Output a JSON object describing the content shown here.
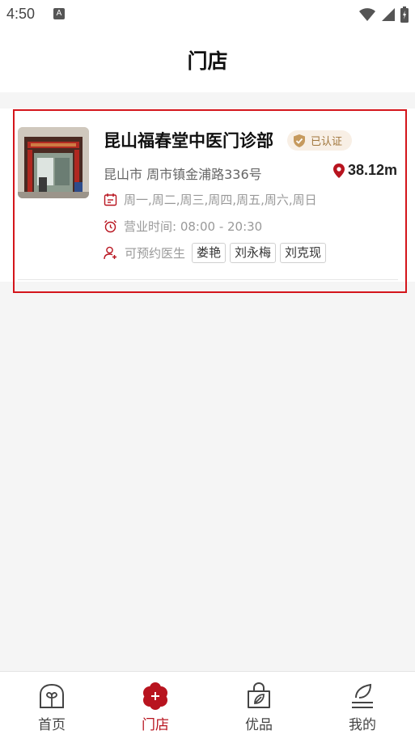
{
  "status_bar": {
    "time": "4:50",
    "app_badge": "A"
  },
  "header": {
    "title": "门店"
  },
  "store": {
    "name": "昆山福春堂中医门诊部",
    "verified": "已认证",
    "address": "昆山市 周市镇金浦路336号",
    "distance": "38.12m",
    "days": "周一,周二,周三,周四,周五,周六,周日",
    "hours": "营业时间: 08:00 - 20:30",
    "doctors_label": "可预约医生",
    "doctors": [
      "娄艳",
      "刘永梅",
      "刘克现"
    ]
  },
  "tabs": [
    {
      "label": "首页",
      "icon": "home-icon",
      "active": false
    },
    {
      "label": "门店",
      "icon": "store-icon",
      "active": true
    },
    {
      "label": "优品",
      "icon": "shopping-bag-icon",
      "active": false
    },
    {
      "label": "我的",
      "icon": "profile-icon",
      "active": false
    }
  ],
  "colors": {
    "accent": "#b8141f",
    "highlight_border": "#d4151b",
    "badge_bg": "#f8efe5",
    "badge_text": "#a0763c"
  }
}
